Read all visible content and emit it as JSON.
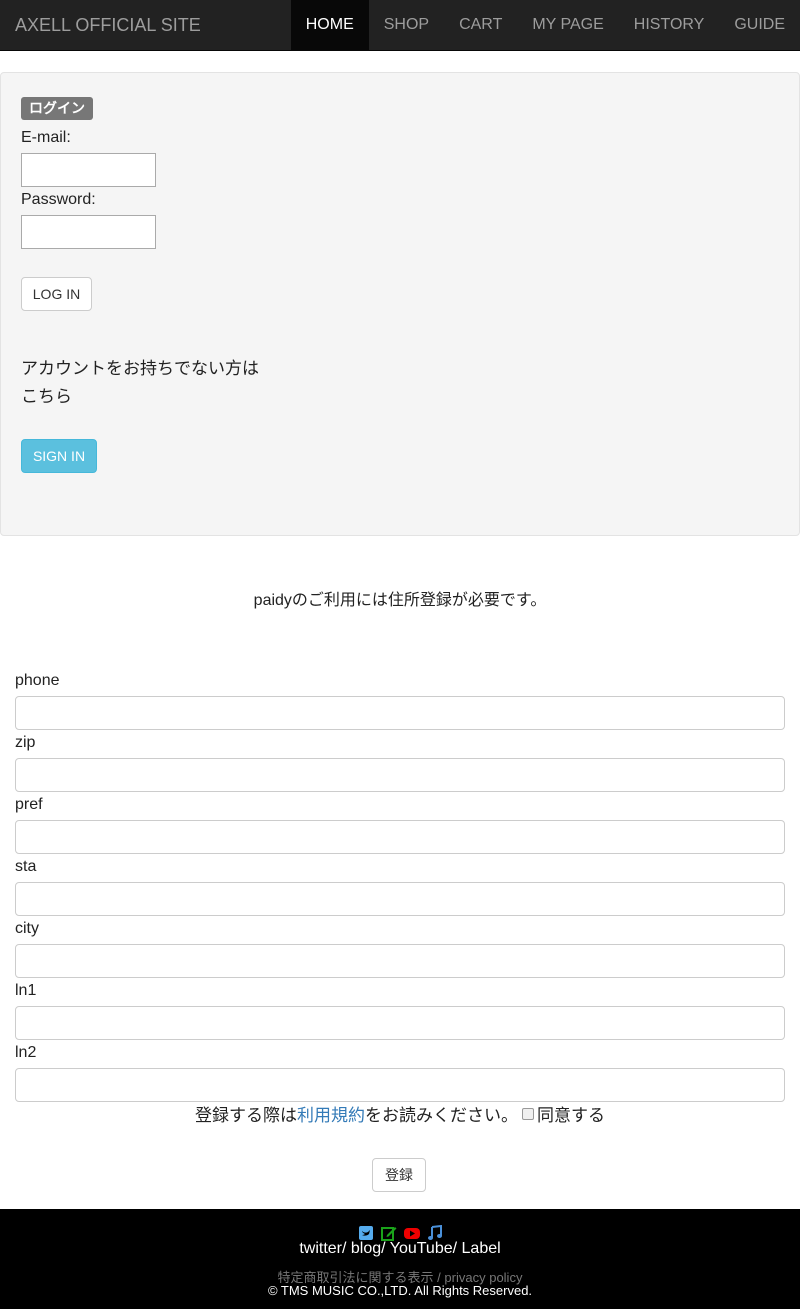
{
  "navbar": {
    "brand": "AXELL OFFICIAL SITE",
    "items": [
      {
        "label": "HOME",
        "active": true
      },
      {
        "label": "SHOP"
      },
      {
        "label": "CART"
      },
      {
        "label": "MY PAGE"
      },
      {
        "label": "HISTORY"
      },
      {
        "label": "GUIDE"
      }
    ]
  },
  "login": {
    "badge": "ログイン",
    "email_label": "E-mail:",
    "email_value": "",
    "password_label": "Password:",
    "password_value": "",
    "login_button": "LOG IN",
    "no_account_line1": "アカウントをお持ちでない方は",
    "no_account_line2": "こちら",
    "signin_button": "SIGN IN"
  },
  "notice": "paidyのご利用には住所登録が必要です。",
  "form": {
    "fields": [
      {
        "label": "phone",
        "value": ""
      },
      {
        "label": "zip",
        "value": ""
      },
      {
        "label": "pref",
        "value": ""
      },
      {
        "label": "sta",
        "value": ""
      },
      {
        "label": "city",
        "value": ""
      },
      {
        "label": "ln1",
        "value": ""
      },
      {
        "label": "ln2",
        "value": ""
      }
    ],
    "terms_prefix": "登録する際は",
    "terms_link": "利用規約",
    "terms_suffix": "をお読みください。",
    "agree_label": "同意する",
    "agree_checked": false,
    "submit_button": "登録"
  },
  "footer": {
    "icons": [
      "twitter-icon",
      "blog-icon",
      "youtube-icon",
      "music-note-icon"
    ],
    "links": [
      "twitter",
      "blog",
      "YouTube",
      "Label"
    ],
    "separator": "/",
    "legal_link": "特定商取引法に関する表示",
    "privacy_link": "privacy policy",
    "copyright": "© TMS MUSIC CO.,LTD. All Rights Reserved."
  },
  "colors": {
    "navbar_bg": "#222222",
    "active_bg": "#080808",
    "info_button": "#5bc0de",
    "link": "#337ab7",
    "twitter_icon": "#55acee",
    "blog_icon": "#1aa31a",
    "youtube_icon": "#ee0000",
    "music_icon": "#4a90d9"
  }
}
